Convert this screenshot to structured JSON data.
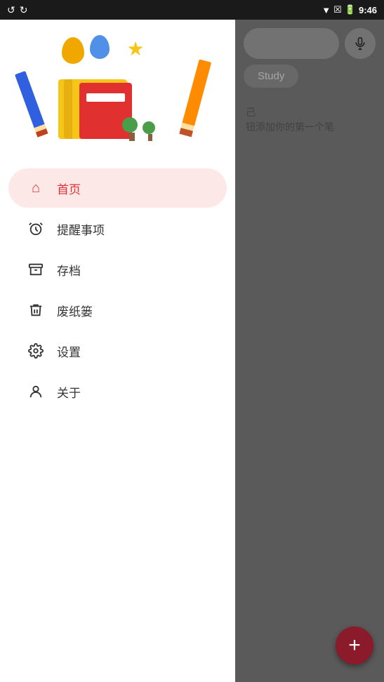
{
  "statusBar": {
    "time": "9:46",
    "icons": [
      "refresh-left-icon",
      "refresh-right-icon",
      "wifi-icon",
      "signal-icon",
      "battery-icon"
    ]
  },
  "sidebar": {
    "items": [
      {
        "id": "home",
        "label": "首页",
        "icon": "home-icon",
        "active": true
      },
      {
        "id": "reminders",
        "label": "提醒事项",
        "icon": "alarm-icon",
        "active": false
      },
      {
        "id": "archive",
        "label": "存档",
        "icon": "archive-icon",
        "active": false
      },
      {
        "id": "trash",
        "label": "废纸篓",
        "icon": "trash-icon",
        "active": false
      },
      {
        "id": "settings",
        "label": "设置",
        "icon": "settings-icon",
        "active": false
      },
      {
        "id": "about",
        "label": "关于",
        "icon": "person-icon",
        "active": false
      }
    ]
  },
  "header": {
    "searchPlaceholder": "",
    "tagLabel": "Study"
  },
  "content": {
    "emptyLine1": "己",
    "emptyLine2": "钮添加你的第一个笔"
  },
  "fab": {
    "label": "+"
  }
}
